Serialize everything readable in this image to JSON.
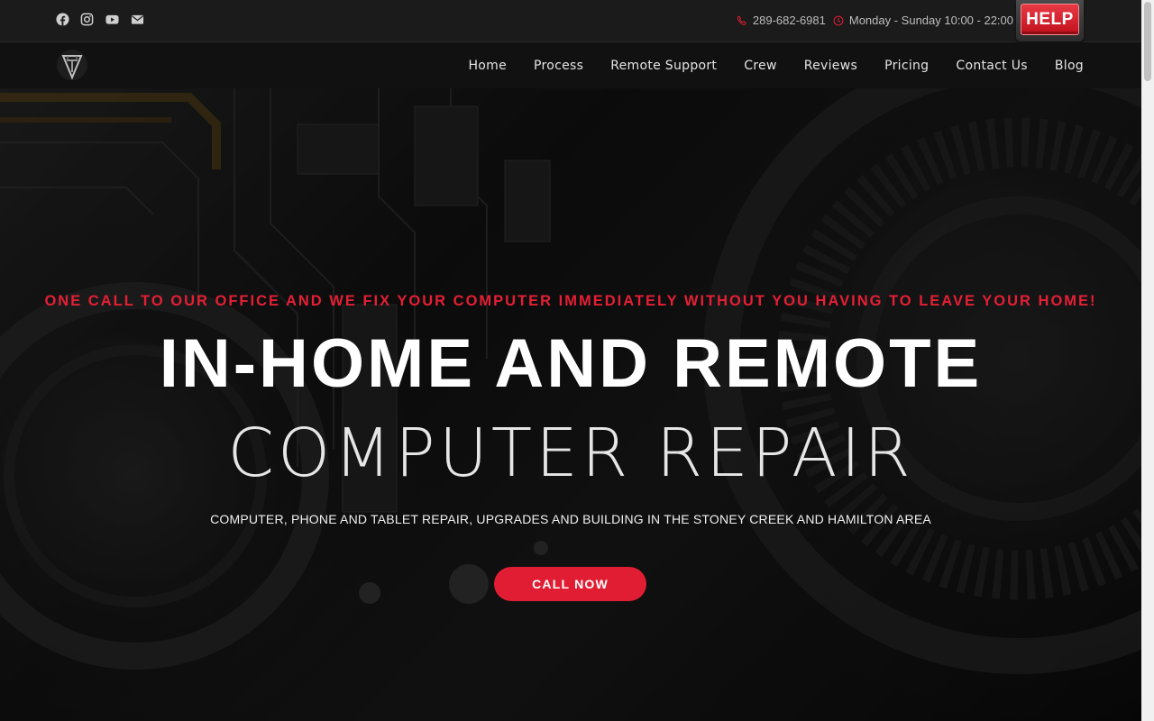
{
  "topbar": {
    "social_icons": [
      "facebook-icon",
      "instagram-icon",
      "youtube-icon",
      "envelope-icon"
    ],
    "phone": "289-682-6981",
    "hours": "Monday - Sunday 10:00 - 22:00",
    "help_label": "HELP"
  },
  "nav": {
    "items": [
      {
        "label": "Home"
      },
      {
        "label": "Process"
      },
      {
        "label": "Remote Support"
      },
      {
        "label": "Crew"
      },
      {
        "label": "Reviews"
      },
      {
        "label": "Pricing"
      },
      {
        "label": "Contact Us"
      },
      {
        "label": "Blog"
      }
    ]
  },
  "hero": {
    "tagline": "ONE CALL TO OUR OFFICE AND WE FIX YOUR COMPUTER IMMEDIATELY WITHOUT YOU HAVING TO LEAVE YOUR HOME!",
    "headline": "IN-HOME AND REMOTE",
    "subheadline": "COMPUTER REPAIR",
    "description": "COMPUTER, PHONE AND TABLET REPAIR, UPGRADES AND BUILDING IN THE STONEY CREEK AND HAMILTON AREA",
    "cta_label": "CALL NOW"
  },
  "colors": {
    "accent_red": "#e11d33",
    "topbar_bg": "#1b1b1b",
    "nav_bg": "#111111"
  }
}
